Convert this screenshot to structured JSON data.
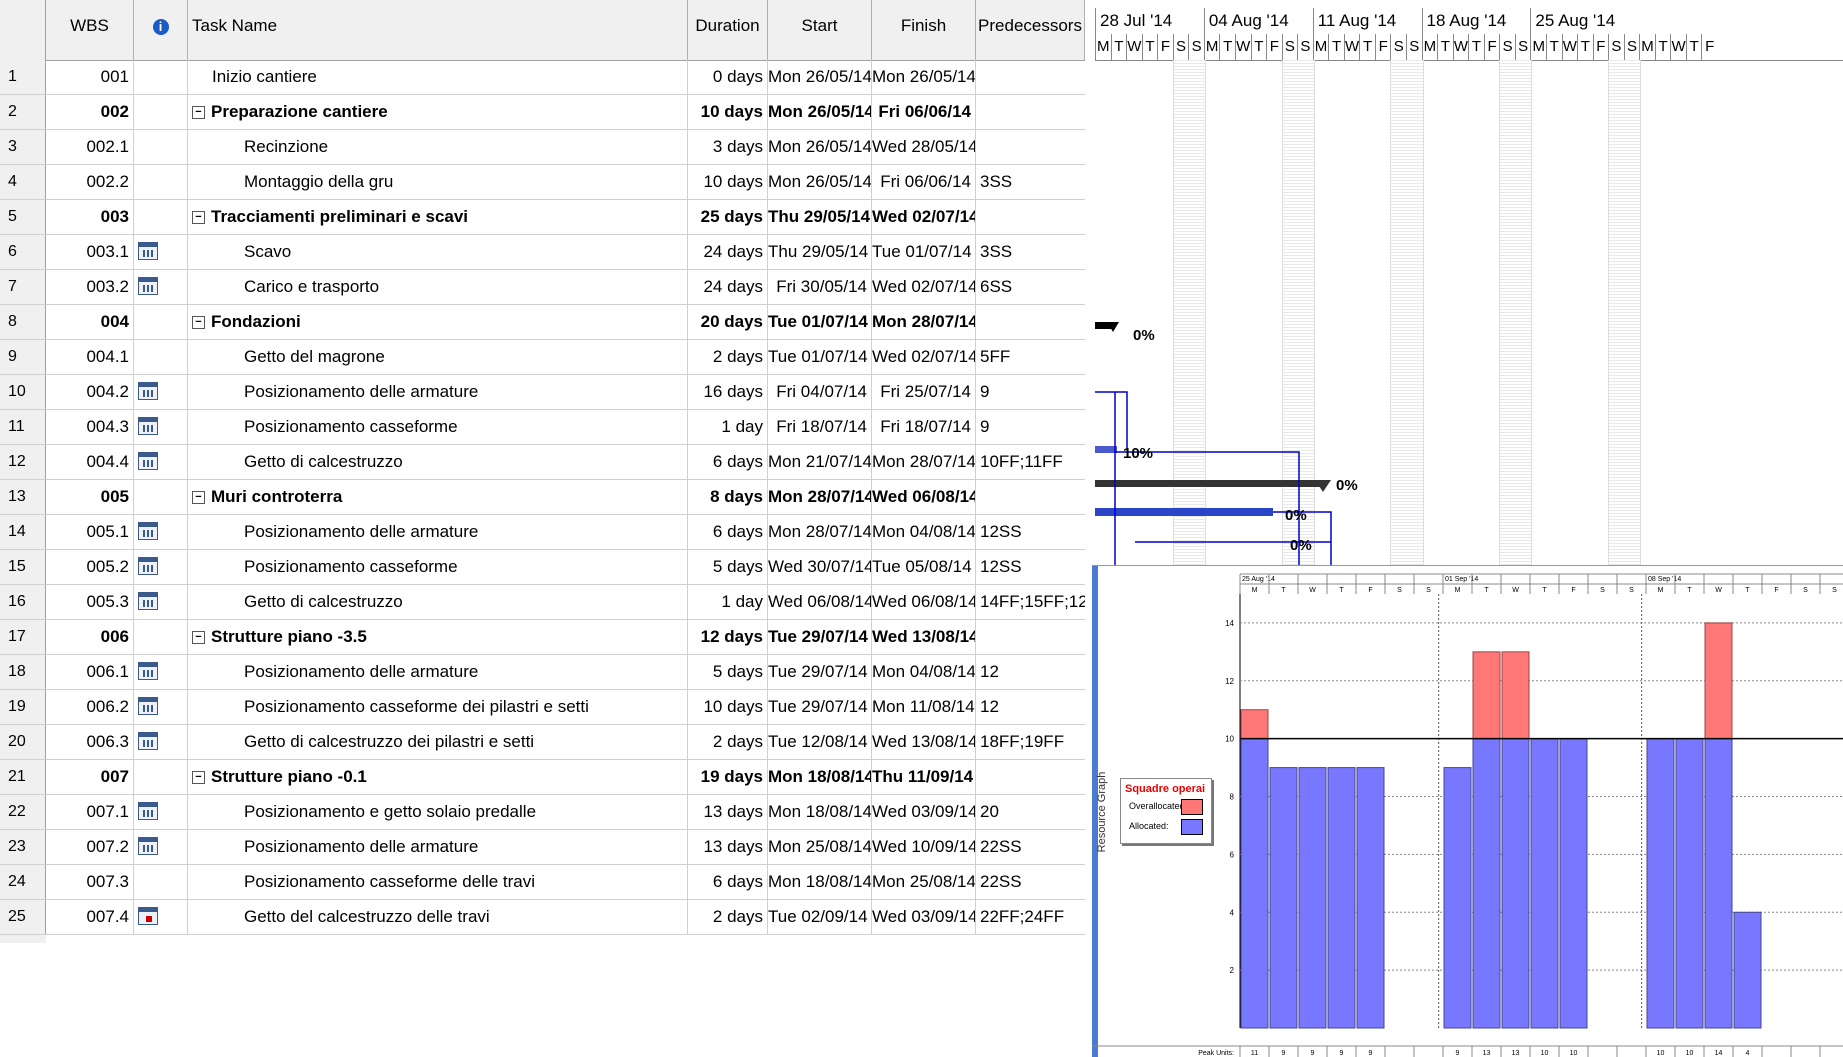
{
  "columns": {
    "wbs": "WBS",
    "info": "i",
    "task_name": "Task Name",
    "duration": "Duration",
    "start": "Start",
    "finish": "Finish",
    "predecessors": "Predecessors"
  },
  "tasks": [
    {
      "n": "1",
      "wbs": "001",
      "name": "Inizio cantiere",
      "dur": "0 days",
      "start": "Mon 26/05/14",
      "finish": "Mon 26/05/14",
      "pred": "",
      "summary": false,
      "icon": ""
    },
    {
      "n": "2",
      "wbs": "002",
      "name": "Preparazione cantiere",
      "dur": "10 days",
      "start": "Mon 26/05/14",
      "finish": "Fri 06/06/14",
      "pred": "",
      "summary": true,
      "icon": ""
    },
    {
      "n": "3",
      "wbs": "002.1",
      "name": "Recinzione",
      "dur": "3 days",
      "start": "Mon 26/05/14",
      "finish": "Wed 28/05/14",
      "pred": "",
      "summary": false,
      "icon": ""
    },
    {
      "n": "4",
      "wbs": "002.2",
      "name": "Montaggio della gru",
      "dur": "10 days",
      "start": "Mon 26/05/14",
      "finish": "Fri 06/06/14",
      "pred": "3SS",
      "summary": false,
      "icon": ""
    },
    {
      "n": "5",
      "wbs": "003",
      "name": "Tracciamenti preliminari e scavi",
      "dur": "25 days",
      "start": "Thu 29/05/14",
      "finish": "Wed 02/07/14",
      "pred": "",
      "summary": true,
      "icon": ""
    },
    {
      "n": "6",
      "wbs": "003.1",
      "name": "Scavo",
      "dur": "24 days",
      "start": "Thu 29/05/14",
      "finish": "Tue 01/07/14",
      "pred": "3SS",
      "summary": false,
      "icon": "calendar"
    },
    {
      "n": "7",
      "wbs": "003.2",
      "name": "Carico e trasporto",
      "dur": "24 days",
      "start": "Fri 30/05/14",
      "finish": "Wed 02/07/14",
      "pred": "6SS",
      "summary": false,
      "icon": "calendar"
    },
    {
      "n": "8",
      "wbs": "004",
      "name": "Fondazioni",
      "dur": "20 days",
      "start": "Tue 01/07/14",
      "finish": "Mon 28/07/14",
      "pred": "",
      "summary": true,
      "icon": ""
    },
    {
      "n": "9",
      "wbs": "004.1",
      "name": "Getto del magrone",
      "dur": "2 days",
      "start": "Tue 01/07/14",
      "finish": "Wed 02/07/14",
      "pred": "5FF",
      "summary": false,
      "icon": ""
    },
    {
      "n": "10",
      "wbs": "004.2",
      "name": "Posizionamento delle armature",
      "dur": "16 days",
      "start": "Fri 04/07/14",
      "finish": "Fri 25/07/14",
      "pred": "9",
      "summary": false,
      "icon": "calendar"
    },
    {
      "n": "11",
      "wbs": "004.3",
      "name": "Posizionamento casseforme",
      "dur": "1 day",
      "start": "Fri 18/07/14",
      "finish": "Fri 18/07/14",
      "pred": "9",
      "summary": false,
      "icon": "calendar"
    },
    {
      "n": "12",
      "wbs": "004.4",
      "name": "Getto di calcestruzzo",
      "dur": "6 days",
      "start": "Mon 21/07/14",
      "finish": "Mon 28/07/14",
      "pred": "10FF;11FF",
      "summary": false,
      "icon": "calendar"
    },
    {
      "n": "13",
      "wbs": "005",
      "name": "Muri controterra",
      "dur": "8 days",
      "start": "Mon 28/07/14",
      "finish": "Wed 06/08/14",
      "pred": "",
      "summary": true,
      "icon": ""
    },
    {
      "n": "14",
      "wbs": "005.1",
      "name": "Posizionamento delle armature",
      "dur": "6 days",
      "start": "Mon 28/07/14",
      "finish": "Mon 04/08/14",
      "pred": "12SS",
      "summary": false,
      "icon": "calendar"
    },
    {
      "n": "15",
      "wbs": "005.2",
      "name": "Posizionamento casseforme",
      "dur": "5 days",
      "start": "Wed 30/07/14",
      "finish": "Tue 05/08/14",
      "pred": "12SS",
      "summary": false,
      "icon": "calendar"
    },
    {
      "n": "16",
      "wbs": "005.3",
      "name": "Getto di calcestruzzo",
      "dur": "1 day",
      "start": "Wed 06/08/14",
      "finish": "Wed 06/08/14",
      "pred": "14FF;15FF;12",
      "summary": false,
      "icon": "calendar"
    },
    {
      "n": "17",
      "wbs": "006",
      "name": "Strutture piano -3.5",
      "dur": "12 days",
      "start": "Tue 29/07/14",
      "finish": "Wed 13/08/14",
      "pred": "",
      "summary": true,
      "icon": ""
    },
    {
      "n": "18",
      "wbs": "006.1",
      "name": "Posizionamento delle armature",
      "dur": "5 days",
      "start": "Tue 29/07/14",
      "finish": "Mon 04/08/14",
      "pred": "12",
      "summary": false,
      "icon": "calendar"
    },
    {
      "n": "19",
      "wbs": "006.2",
      "name": "Posizionamento casseforme dei pilastri e setti",
      "dur": "10 days",
      "start": "Tue 29/07/14",
      "finish": "Mon 11/08/14",
      "pred": "12",
      "summary": false,
      "icon": "calendar"
    },
    {
      "n": "20",
      "wbs": "006.3",
      "name": "Getto di calcestruzzo dei pilastri e setti",
      "dur": "2 days",
      "start": "Tue 12/08/14",
      "finish": "Wed 13/08/14",
      "pred": "18FF;19FF",
      "summary": false,
      "icon": "calendar"
    },
    {
      "n": "21",
      "wbs": "007",
      "name": "Strutture piano -0.1",
      "dur": "19 days",
      "start": "Mon 18/08/14",
      "finish": "Thu 11/09/14",
      "pred": "",
      "summary": true,
      "icon": ""
    },
    {
      "n": "22",
      "wbs": "007.1",
      "name": "Posizionamento e getto solaio predalle",
      "dur": "13 days",
      "start": "Mon 18/08/14",
      "finish": "Wed 03/09/14",
      "pred": "20",
      "summary": false,
      "icon": "calendar"
    },
    {
      "n": "23",
      "wbs": "007.2",
      "name": "Posizionamento delle armature",
      "dur": "13 days",
      "start": "Mon 25/08/14",
      "finish": "Wed 10/09/14",
      "pred": "22SS",
      "summary": false,
      "icon": "calendar"
    },
    {
      "n": "24",
      "wbs": "007.3",
      "name": "Posizionamento casseforme delle travi",
      "dur": "6 days",
      "start": "Mon 18/08/14",
      "finish": "Mon 25/08/14",
      "pred": "22SS",
      "summary": false,
      "icon": ""
    },
    {
      "n": "25",
      "wbs": "007.4",
      "name": "Getto del calcestruzzo delle travi",
      "dur": "2 days",
      "start": "Tue 02/09/14",
      "finish": "Wed 03/09/14",
      "pred": "22FF;24FF",
      "summary": false,
      "icon": "calendar-red"
    }
  ],
  "gantt": {
    "weeks": [
      "28 Jul '14",
      "04 Aug '14",
      "11 Aug '14",
      "18 Aug '14",
      "25 Aug '14"
    ],
    "day_letters": [
      "M",
      "T",
      "W",
      "T",
      "F",
      "S",
      "S"
    ],
    "pct_labels": [
      "0%",
      "10%",
      "0%",
      "0%",
      "0%"
    ]
  },
  "resource_graph": {
    "side_label": "Resource Graph",
    "weeks": [
      "25 Aug '14",
      "01 Sep '14",
      "08 Sep '14"
    ],
    "legend_title": "Squadre operai",
    "legend_over": "Overallocated:",
    "legend_alloc": "Allocated:",
    "peak_label": "Peak Units:",
    "colors": {
      "over": "#f77",
      "alloc": "#77f"
    }
  },
  "chart_data": {
    "type": "bar",
    "categories": [
      "M",
      "T",
      "W",
      "T",
      "F",
      "S",
      "S",
      "M",
      "T",
      "W",
      "T",
      "F",
      "S",
      "S",
      "M",
      "T",
      "W",
      "T",
      "F",
      "S",
      "S"
    ],
    "peak_units": [
      11,
      9,
      9,
      9,
      9,
      null,
      null,
      9,
      13,
      13,
      10,
      10,
      null,
      null,
      10,
      10,
      14,
      4,
      null,
      null,
      null
    ],
    "series": [
      {
        "name": "Overallocated",
        "values": [
          1,
          0,
          0,
          0,
          0,
          0,
          0,
          0,
          3,
          3,
          0,
          0,
          0,
          0,
          0,
          0,
          4,
          0,
          0,
          0,
          0
        ]
      },
      {
        "name": "Allocated",
        "values": [
          10,
          9,
          9,
          9,
          9,
          0,
          0,
          9,
          10,
          10,
          10,
          10,
          0,
          0,
          10,
          10,
          10,
          4,
          0,
          0,
          0
        ]
      }
    ],
    "yticks": [
      2,
      4,
      6,
      8,
      10,
      12,
      14
    ],
    "ylim": [
      0,
      15
    ],
    "max_line": 10
  }
}
